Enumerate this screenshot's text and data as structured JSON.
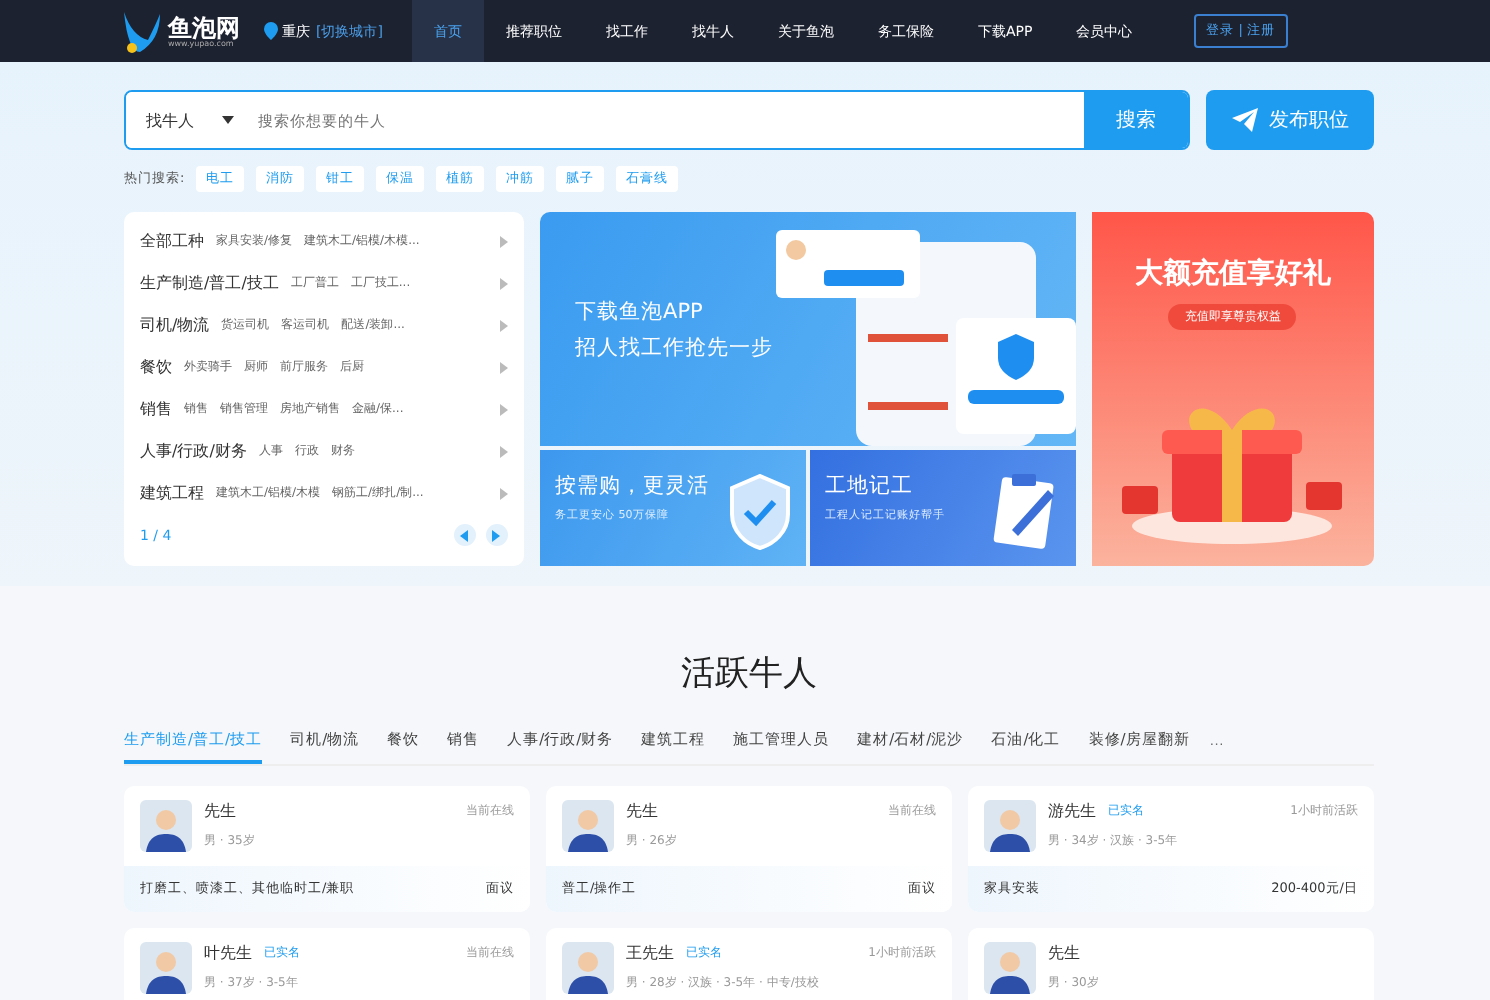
{
  "header": {
    "logo": "鱼泡网",
    "logo_sub": "www.yupao.com",
    "city": "重庆",
    "switch_city": "[切换城市]",
    "nav": [
      {
        "label": "首页",
        "selected": true
      },
      {
        "label": "推荐职位",
        "selected": false
      },
      {
        "label": "找工作",
        "selected": false
      },
      {
        "label": "找牛人",
        "selected": false
      },
      {
        "label": "关于鱼泡",
        "selected": false
      },
      {
        "label": "务工保险",
        "selected": false
      },
      {
        "label": "下载APP",
        "selected": false
      },
      {
        "label": "会员中心",
        "selected": false
      }
    ],
    "login": "登录 | 注册"
  },
  "search": {
    "type": "找牛人",
    "placeholder": "搜索你想要的牛人",
    "button": "搜索",
    "post": "发布职位"
  },
  "hot": {
    "label": "热门搜索:",
    "items": [
      "电工",
      "消防",
      "钳工",
      "保温",
      "植筋",
      "冲筋",
      "腻子",
      "石膏线"
    ]
  },
  "categories": [
    {
      "title": "全部工种",
      "subs": [
        "家具安装/修复",
        "建筑木工/铝模/木模..."
      ]
    },
    {
      "title": "生产制造/普工/技工",
      "subs": [
        "工厂普工",
        "工厂技工..."
      ]
    },
    {
      "title": "司机/物流",
      "subs": [
        "货运司机",
        "客运司机",
        "配送/装卸..."
      ]
    },
    {
      "title": "餐饮",
      "subs": [
        "外卖骑手",
        "厨师",
        "前厅服务",
        "后厨"
      ]
    },
    {
      "title": "销售",
      "subs": [
        "销售",
        "销售管理",
        "房地产销售",
        "金融/保..."
      ]
    },
    {
      "title": "人事/行政/财务",
      "subs": [
        "人事",
        "行政",
        "财务"
      ]
    },
    {
      "title": "建筑工程",
      "subs": [
        "建筑木工/铝模/木模",
        "钢筋工/绑扎/制..."
      ]
    }
  ],
  "category_pager": "1 / 4",
  "banners": {
    "app_title": "下载鱼泡APP",
    "app_sub": "招人找工作抢先一步",
    "buy_title": "按需购，更灵活",
    "buy_sub": "务工更安心 50万保障",
    "record_title": "工地记工",
    "record_sub": "工程人记工记账好帮手",
    "gift_title": "大额充值享好礼",
    "gift_sub": "充值即享尊贵权益"
  },
  "section_title": "活跃牛人",
  "tabs": [
    {
      "label": "生产制造/普工/技工",
      "selected": true
    },
    {
      "label": "司机/物流",
      "selected": false
    },
    {
      "label": "餐饮",
      "selected": false
    },
    {
      "label": "销售",
      "selected": false
    },
    {
      "label": "人事/行政/财务",
      "selected": false
    },
    {
      "label": "建筑工程",
      "selected": false
    },
    {
      "label": "施工管理人员",
      "selected": false
    },
    {
      "label": "建材/石材/泥沙",
      "selected": false
    },
    {
      "label": "石油/化工",
      "selected": false
    },
    {
      "label": "装修/房屋翻新",
      "selected": false
    }
  ],
  "more": "···",
  "workers": [
    {
      "name": "先生",
      "status": "当前在线",
      "meta": "男 · 35岁",
      "skills": "打磨工、喷漆工、其他临时工/兼职",
      "salary": "面议"
    },
    {
      "name": "先生",
      "status": "当前在线",
      "meta": "男 · 26岁",
      "skills": "普工/操作工",
      "salary": "面议"
    },
    {
      "name": "游先生",
      "badge": "已实名",
      "status": "1小时前活跃",
      "meta": "男 · 34岁 · 汉族 · 3-5年",
      "skills": "家具安装",
      "salary": "200-400元/日"
    },
    {
      "name": "叶先生",
      "badge": "已实名",
      "status": "当前在线",
      "meta": "男 · 37岁 · 3-5年"
    },
    {
      "name": "王先生",
      "badge": "已实名",
      "status": "1小时前活跃",
      "meta": "男 · 28岁 · 汉族 · 3-5年 · 中专/技校"
    },
    {
      "name": "先生",
      "meta": "男 · 30岁"
    }
  ]
}
